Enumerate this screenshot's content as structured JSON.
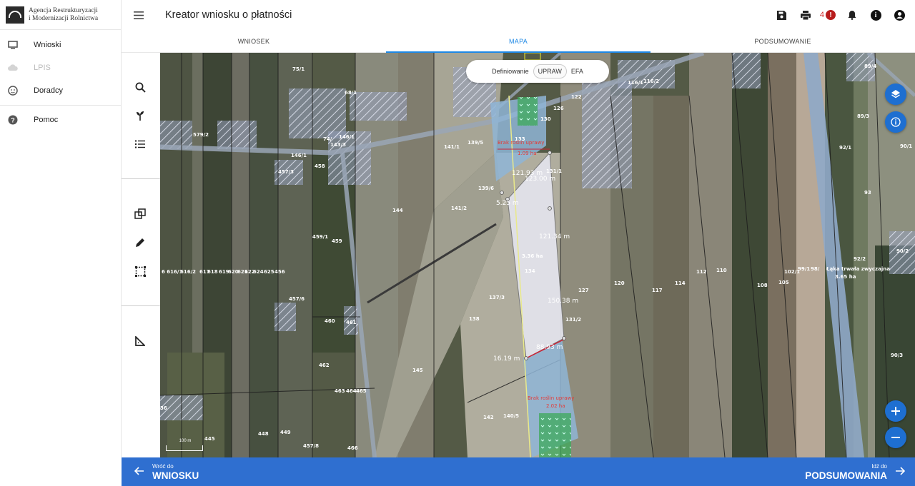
{
  "logo": {
    "line1": "Agencja Restrukturyzacji",
    "line2": "i Modernizacji Rolnictwa"
  },
  "nav": {
    "items": [
      {
        "label": "Wnioski",
        "icon": "monitor-icon"
      },
      {
        "label": "LPIS",
        "icon": "cloud-icon"
      },
      {
        "label": "Doradcy",
        "icon": "face-icon"
      },
      {
        "label": "Pomoc",
        "icon": "help-icon"
      }
    ]
  },
  "header": {
    "title": "Kreator wniosku o płatności",
    "error_count": "4"
  },
  "tabs": [
    {
      "label": "WNIOSEK"
    },
    {
      "label": "MAPA"
    },
    {
      "label": "PODSUMOWANIE"
    }
  ],
  "map": {
    "defining": {
      "label": "Definiowanie",
      "options": [
        "UPRAW",
        "EFA"
      ],
      "selected": "UPRAW"
    },
    "scale": "100 m",
    "measures": {
      "m1": "121.93 m",
      "m2": "123.00 m",
      "m3": "121.34 m",
      "m4": "150.38 m",
      "m5": "16.19 m",
      "m6": "88.93 m",
      "m7": "5.25 m",
      "area_center": "3.36 ha"
    },
    "red_labels": {
      "top1": "Brak roślin uprawy",
      "top2": "1.09 ha",
      "bottom1": "Brak roślin uprawy",
      "bottom2": "2.02 ha"
    },
    "ley_label": {
      "line1": "Łąka trwała zwyczajna",
      "line2": "3.65 ha"
    }
  },
  "footer": {
    "back": {
      "small": "Wróć do",
      "big": "WNIOSKU"
    },
    "next": {
      "small": "Idź do",
      "big": "PODSUMOWANIA"
    }
  },
  "colors": {
    "accent": "#1e88e5",
    "footer": "#2f6fd0",
    "error": "#b71c1c"
  }
}
